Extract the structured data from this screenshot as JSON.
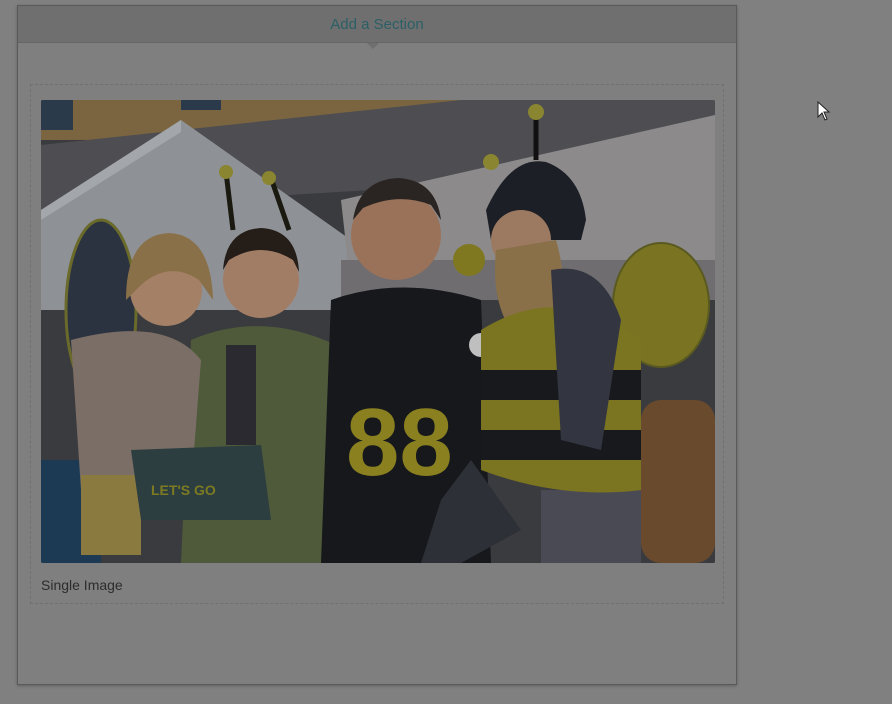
{
  "panel": {
    "add_section_label": "Add a Section"
  },
  "block": {
    "caption": "Single Image",
    "image": {
      "jersey_number": "88",
      "book_text": "LET'S GO"
    }
  },
  "icons": {
    "cursor": "mouse-pointer-icon",
    "caret": "caret-down-icon"
  },
  "colors": {
    "overlay_background": "#808080",
    "add_section_text": "#2b5f66",
    "caption_text": "#2c2c2c"
  }
}
